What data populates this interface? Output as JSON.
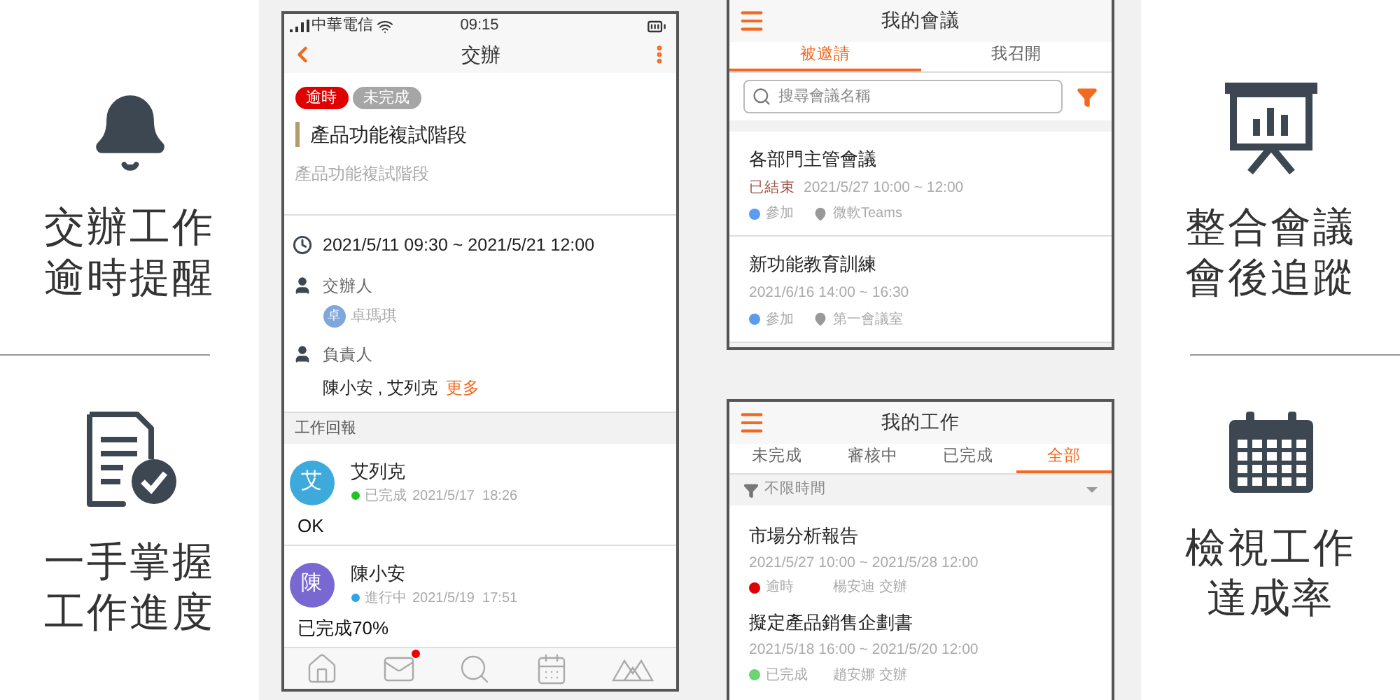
{
  "left_features": [
    {
      "lines": [
        "交辦工作",
        "逾時提醒"
      ]
    },
    {
      "lines": [
        "一手掌握",
        "工作進度"
      ]
    }
  ],
  "task_screen": {
    "status_bar": {
      "carrier": "中華電信",
      "time": "09:15"
    },
    "title": "交辦",
    "tags": [
      {
        "label": "逾時",
        "color": "#e00000"
      },
      {
        "label": "未完成",
        "color": "#a6a6a6"
      }
    ],
    "heading": "產品功能複試階段",
    "subheading": "產品功能複試階段",
    "time_range": "2021/5/11 09:30 ~ 2021/5/21 12:00",
    "assigner_label": "交辦人",
    "assigner": {
      "initial": "卓",
      "name": "卓瑪琪"
    },
    "owner_label": "負責人",
    "owners": "陳小安 , 艾列克",
    "more": "更多",
    "section": "工作回報",
    "reports": [
      {
        "initial": "艾",
        "name": "艾列克",
        "status": "已完成",
        "color": "#22c322",
        "time": "2021/5/17  18:26",
        "text": "OK"
      },
      {
        "initial": "陳",
        "name": "陳小安",
        "status": "進行中",
        "color": "#2ea6e6",
        "time": "2021/5/19  17:51",
        "text": "已完成70%"
      }
    ],
    "tab_bar": [
      {
        "kind": "home",
        "badge": false
      },
      {
        "kind": "mail",
        "badge": true
      },
      {
        "kind": "search",
        "badge": false
      },
      {
        "kind": "calendar",
        "badge": false
      },
      {
        "kind": "logo",
        "badge": false
      }
    ]
  },
  "meetings_screen": {
    "title": "我的會議",
    "tabs": [
      {
        "label": "被邀請",
        "selected": true
      },
      {
        "label": "我召開",
        "selected": false
      }
    ],
    "search": {
      "placeholder": "搜尋會議名稱"
    },
    "meetings": [
      {
        "title": "各部門主管會議",
        "status": "已結束",
        "time": "2021/5/27 10:00 ~ 12:00",
        "response": "參加",
        "color": "#5b9cf0",
        "location": "微軟Teams"
      },
      {
        "title": "新功能教育訓練",
        "time": "2021/6/16 14:00 ~ 16:30",
        "response": "參加",
        "color": "#5b9cf0",
        "location": "第一會議室"
      }
    ]
  },
  "work_screen": {
    "title": "我的工作",
    "tabs": [
      {
        "label": "未完成",
        "selected": false
      },
      {
        "label": "審核中",
        "selected": false
      },
      {
        "label": "已完成",
        "selected": false
      },
      {
        "label": "全部",
        "selected": true
      }
    ],
    "filter": "不限時間",
    "tasks": [
      {
        "title": "市場分析報告",
        "time": "2021/5/27 10:00 ~ 2021/5/28 12:00",
        "status": "逾時",
        "color": "#e00000",
        "assigner": "楊安迪 交辦"
      },
      {
        "title": "擬定產品銷售企劃書",
        "time": "2021/5/18 16:00 ~ 2021/5/20 12:00",
        "status": "已完成",
        "color": "#6fd46f",
        "assigner": "趙安娜 交辦"
      }
    ]
  },
  "right_features": [
    {
      "lines": [
        "整合會議",
        "會後追蹤"
      ]
    },
    {
      "lines": [
        "檢視工作",
        "達成率"
      ]
    }
  ]
}
